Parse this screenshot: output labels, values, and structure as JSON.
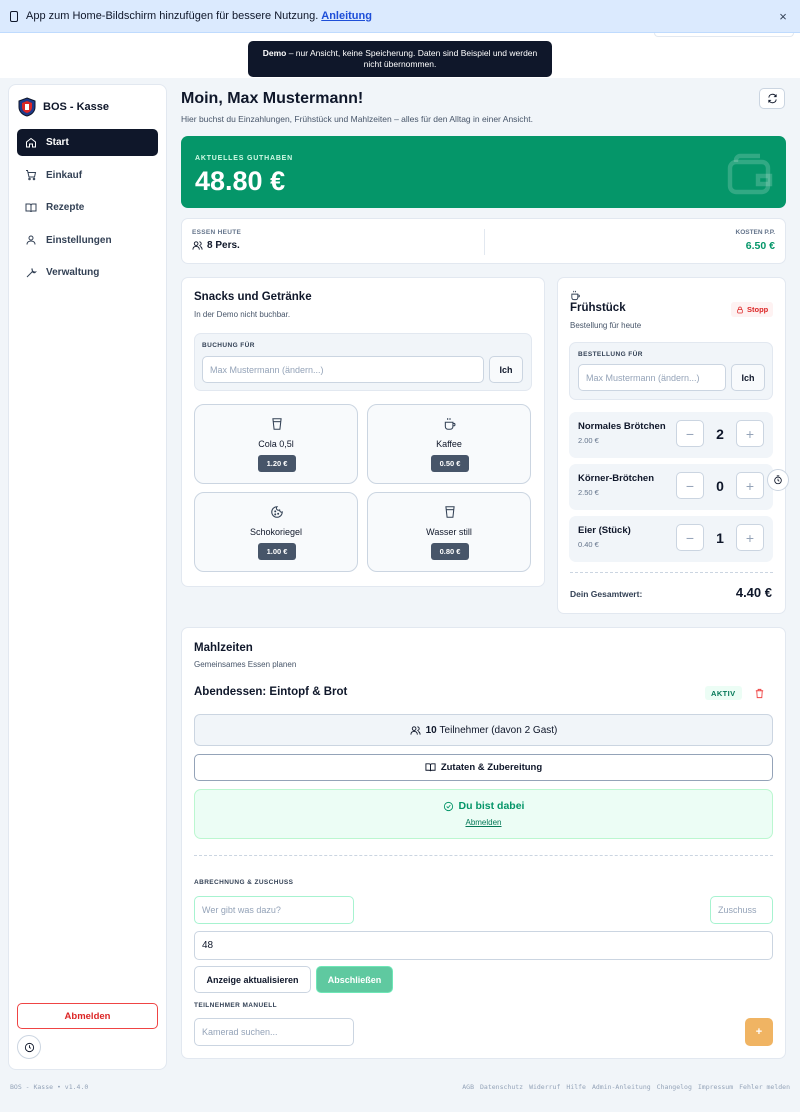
{
  "banner": {
    "text": "App zum Home-Bildschirm hinzufügen für bessere Nutzung.",
    "link": "Anleitung",
    "close": "×"
  },
  "demo": {
    "bold": "Demo",
    "text": " – nur Ansicht, keine Speicherung. Daten sind Beispiel und werden nicht übernommen."
  },
  "sidebar": {
    "brand": "BOS - Kasse",
    "items": [
      {
        "label": "Start",
        "icon": "home-icon",
        "active": true
      },
      {
        "label": "Einkauf",
        "icon": "cart-icon"
      },
      {
        "label": "Rezepte",
        "icon": "book-icon"
      },
      {
        "label": "Einstellungen",
        "icon": "user-icon"
      },
      {
        "label": "Verwaltung",
        "icon": "wrench-icon"
      }
    ],
    "logout": "Abmelden"
  },
  "header": {
    "greeting": "Moin, Max Mustermann!",
    "subtitle": "Hier buchst du Einzahlungen, Frühstück und Mahlzeiten – alles für den Alltag in einer Ansicht."
  },
  "balance": {
    "label": "AKTUELLES GUTHABEN",
    "amount": "48.80 €"
  },
  "stats": {
    "essen_label": "ESSEN HEUTE",
    "essen_value": "8 Pers.",
    "kosten_label": "KOSTEN P.P.",
    "kosten_value": "6.50 €"
  },
  "snacks": {
    "title": "Snacks und Getränke",
    "subtitle": "In der Demo nicht buchbar.",
    "booking_label": "BUCHUNG FÜR",
    "placeholder": "Max Mustermann (ändern...)",
    "me_button": "Ich",
    "items": [
      {
        "name": "Cola 0,5l",
        "price": "1.20 €",
        "icon": "cup-icon"
      },
      {
        "name": "Kaffee",
        "price": "0.50 €",
        "icon": "coffee-icon"
      },
      {
        "name": "Schokoriegel",
        "price": "1.00 €",
        "icon": "cookie-icon"
      },
      {
        "name": "Wasser still",
        "price": "0.80 €",
        "icon": "cup-icon"
      }
    ]
  },
  "fruehstueck": {
    "title": "Frühstück",
    "subtitle": "Bestellung für heute",
    "stopp": "Stopp",
    "order_label": "BESTELLUNG FÜR",
    "placeholder": "Max Mustermann (ändern...)",
    "me_button": "Ich",
    "items": [
      {
        "name": "Normales Brötchen",
        "price": "2.00 €",
        "qty": "2"
      },
      {
        "name": "Körner-Brötchen",
        "price": "2.50 €",
        "qty": "0"
      },
      {
        "name": "Eier (Stück)",
        "price": "0.40 €",
        "qty": "1"
      }
    ],
    "minus": "−",
    "plus": "+",
    "total_label": "Dein Gesamtwert:",
    "total_value": "4.40 €"
  },
  "mahlzeiten": {
    "title": "Mahlzeiten",
    "subtitle": "Gemeinsames Essen planen",
    "meal": "Abendessen: Eintopf & Brot",
    "status": "AKTIV",
    "participants_count": "10",
    "participants_text": "Teilnehmer (davon 2 Gast)",
    "recipe_button": "Zutaten & Zubereitung",
    "joined": "Du bist dabei",
    "leave": "Abmelden",
    "billing_label": "ABRECHNUNG & ZUSCHUSS",
    "who_placeholder": "Wer gibt was dazu?",
    "zuschuss_placeholder": "Zuschuss",
    "amount_value": "48",
    "update_button": "Anzeige aktualisieren",
    "finish_button": "Abschließen",
    "manual_label": "TEILNEHMER MANUELL",
    "search_placeholder": "Kamerad suchen...",
    "add_button": "+"
  },
  "footer": {
    "version": "BOS - Kasse • v1.4.0",
    "links": [
      "AGB",
      "Datenschutz",
      "Widerruf",
      "Hilfe",
      "Admin-Anleitung",
      "Changelog",
      "Impressum",
      "Fehler melden"
    ]
  },
  "colors": {
    "accent_green": "#059669",
    "dark": "#0f172a",
    "danger": "#dc2626",
    "warn": "#f0b463",
    "success_bg": "#ecfdf5"
  }
}
